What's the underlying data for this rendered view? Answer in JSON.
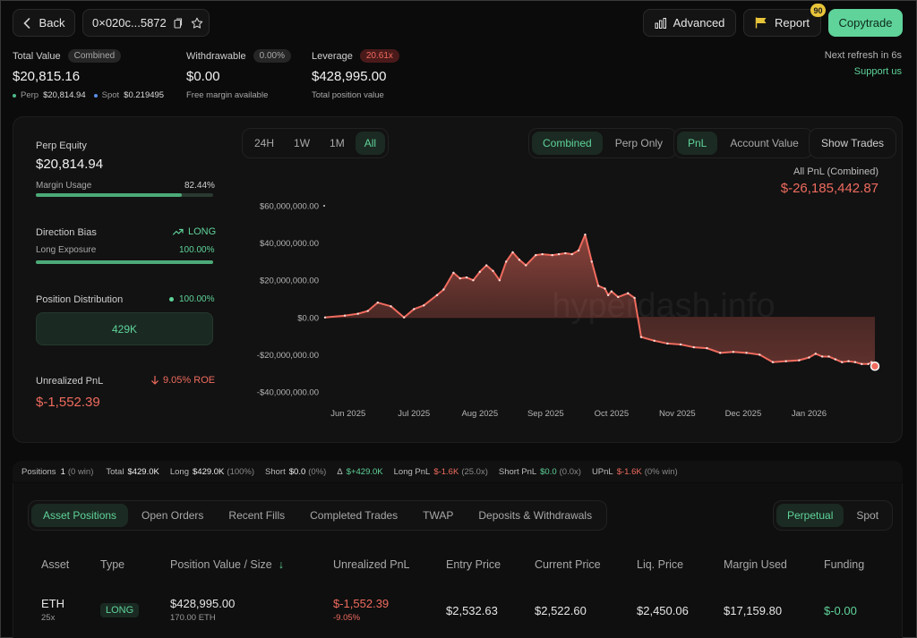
{
  "header": {
    "back_label": "Back",
    "address": "0×020c...5872",
    "advanced_label": "Advanced",
    "report_label": "Report",
    "report_badge": "90",
    "copytrade_label": "Copytrade",
    "refresh_text": "Next refresh in 6s",
    "support_text": "Support us"
  },
  "summary": {
    "total_value_label": "Total Value",
    "total_value_pill": "Combined",
    "total_value": "$20,815.16",
    "perp_label": "Perp",
    "perp_value": "$20,814.94",
    "spot_label": "Spot",
    "spot_value": "$0.219495",
    "withdrawable_label": "Withdrawable",
    "withdrawable_pill": "0.00%",
    "withdrawable_value": "$0.00",
    "withdrawable_sub": "Free margin available",
    "leverage_label": "Leverage",
    "leverage_pill": "20.61x",
    "leverage_value": "$428,995.00",
    "leverage_sub": "Total position value"
  },
  "left_panel": {
    "perp_equity_label": "Perp Equity",
    "perp_equity_value": "$20,814.94",
    "margin_usage_label": "Margin Usage",
    "margin_usage_value": "82.44%",
    "margin_usage_fraction": 0.8244,
    "direction_label": "Direction Bias",
    "direction_value": "LONG",
    "long_exposure_label": "Long Exposure",
    "long_exposure_value": "100.00%",
    "long_exposure_fraction": 1.0,
    "distribution_label": "Position Distribution",
    "distribution_value": "100.00%",
    "distribution_box": "429K",
    "upnl_label": "Unrealized PnL",
    "upnl_roe": "9.05% ROE",
    "upnl_value": "$-1,552.39"
  },
  "chart_controls": {
    "ranges": [
      "24H",
      "1W",
      "1M",
      "All"
    ],
    "active_range": 3,
    "modes": [
      "Combined",
      "Perp Only"
    ],
    "active_mode": 0,
    "metrics": [
      "PnL",
      "Account Value"
    ],
    "active_metric": 0,
    "show_trades_label": "Show Trades",
    "pnl_title": "All PnL (Combined)",
    "pnl_total": "$-26,185,442.87",
    "watermark": "hyperdash.info"
  },
  "chart_data": {
    "type": "area",
    "title": "All PnL (Combined)",
    "xlabel": "",
    "ylabel": "",
    "x_ticks": [
      "Jun 2025",
      "Jul 2025",
      "Aug 2025",
      "Sep 2025",
      "Oct 2025",
      "Nov 2025",
      "Dec 2025",
      "Jan 2026"
    ],
    "y_ticks": [
      "$60,000,000.00",
      "$40,000,000.00",
      "$20,000,000.00",
      "$0.00",
      "-$20,000,000.00",
      "-$40,000,000.00"
    ],
    "y_tick_values": [
      60000000,
      40000000,
      20000000,
      0,
      -20000000,
      -40000000
    ],
    "ylim": [
      -40000000,
      60000000
    ],
    "xlim": [
      0,
      8.5
    ],
    "positive_color": "#ef6b5e",
    "negative_color": "#ef6b5e",
    "series": [
      {
        "x": [
          0,
          0.3,
          0.5,
          0.65,
          0.8,
          1.0,
          1.2,
          1.35,
          1.5,
          1.7,
          1.8,
          1.95,
          2.05,
          2.15,
          2.25,
          2.35,
          2.45,
          2.55,
          2.65,
          2.75,
          2.85,
          2.95,
          3.05,
          3.2,
          3.3,
          3.45,
          3.55,
          3.65,
          3.75,
          3.85,
          3.95,
          4.05,
          4.15,
          4.25,
          4.3,
          4.35,
          4.45,
          4.6,
          4.7,
          4.8,
          5.0,
          5.2,
          5.4,
          5.6,
          5.8,
          6.0,
          6.2,
          6.4,
          6.6,
          6.8,
          7.0,
          7.2,
          7.35,
          7.45,
          7.55,
          7.65,
          7.75,
          7.85,
          7.95,
          8.05,
          8.15,
          8.25,
          8.3,
          8.35
        ],
        "y": [
          0,
          1000000,
          2000000,
          3500000,
          8000000,
          6000000,
          0,
          4500000,
          6500000,
          12000000,
          15000000,
          24000000,
          21000000,
          21500000,
          20000000,
          24500000,
          28000000,
          25000000,
          20000000,
          30000000,
          35000000,
          31000000,
          28000000,
          33500000,
          34000000,
          33500000,
          34000000,
          34500000,
          34000000,
          36000000,
          44500000,
          30000000,
          17000000,
          15500000,
          12000000,
          14000000,
          11000000,
          13000000,
          10500000,
          -10500000,
          -12500000,
          -14000000,
          -14500000,
          -16000000,
          -16500000,
          -19000000,
          -18500000,
          -19000000,
          -20000000,
          -24000000,
          -23500000,
          -23000000,
          -21500000,
          -19500000,
          -21000000,
          -21000000,
          -22500000,
          -24000000,
          -23500000,
          -24000000,
          -25000000,
          -25000000,
          -24000000,
          -26185442.87
        ]
      }
    ]
  },
  "stats_bar": {
    "positions_label": "Positions",
    "positions_value": "1",
    "positions_win": "(0 win)",
    "total_label": "Total",
    "total_value": "$429.0K",
    "long_label": "Long",
    "long_value": "$429.0K",
    "long_pct": "(100%)",
    "short_label": "Short",
    "short_value": "$0.0",
    "short_pct": "(0%)",
    "delta_label": "Δ",
    "delta_value": "$+429.0K",
    "long_pnl_label": "Long PnL",
    "long_pnl_value": "$-1.6K",
    "long_pnl_x": "(25.0x)",
    "short_pnl_label": "Short PnL",
    "short_pnl_value": "$0.0",
    "short_pnl_x": "(0.0x)",
    "upnl_label": "UPnL",
    "upnl_value": "$-1.6K",
    "upnl_win": "(0% win)"
  },
  "positions_tabs": {
    "tabs": [
      "Asset Positions",
      "Open Orders",
      "Recent Fills",
      "Completed Trades",
      "TWAP",
      "Deposits & Withdrawals"
    ],
    "active_tab": 0,
    "market_tabs": [
      "Perpetual",
      "Spot"
    ],
    "active_market": 0
  },
  "table": {
    "headers": [
      "Asset",
      "Type",
      "Position Value / Size",
      "Unrealized PnL",
      "Entry Price",
      "Current Price",
      "Liq. Price",
      "Margin Used",
      "Funding"
    ],
    "rows": [
      {
        "asset": "ETH",
        "leverage": "25x",
        "type": "LONG",
        "position_value": "$428,995.00",
        "size": "170.00 ETH",
        "upnl": "$-1,552.39",
        "upnl_pct": "-9.05%",
        "entry_price": "$2,532.63",
        "current_price": "$2,522.60",
        "liq_price": "$2,450.06",
        "margin_used": "$17,159.80",
        "funding": "$-0.00"
      }
    ]
  },
  "colors": {
    "accent_green": "#5fd39a",
    "negative_red": "#ef6b5e",
    "copytrade_bg": "#5fd39a",
    "report_badge": "#e8c43a"
  }
}
